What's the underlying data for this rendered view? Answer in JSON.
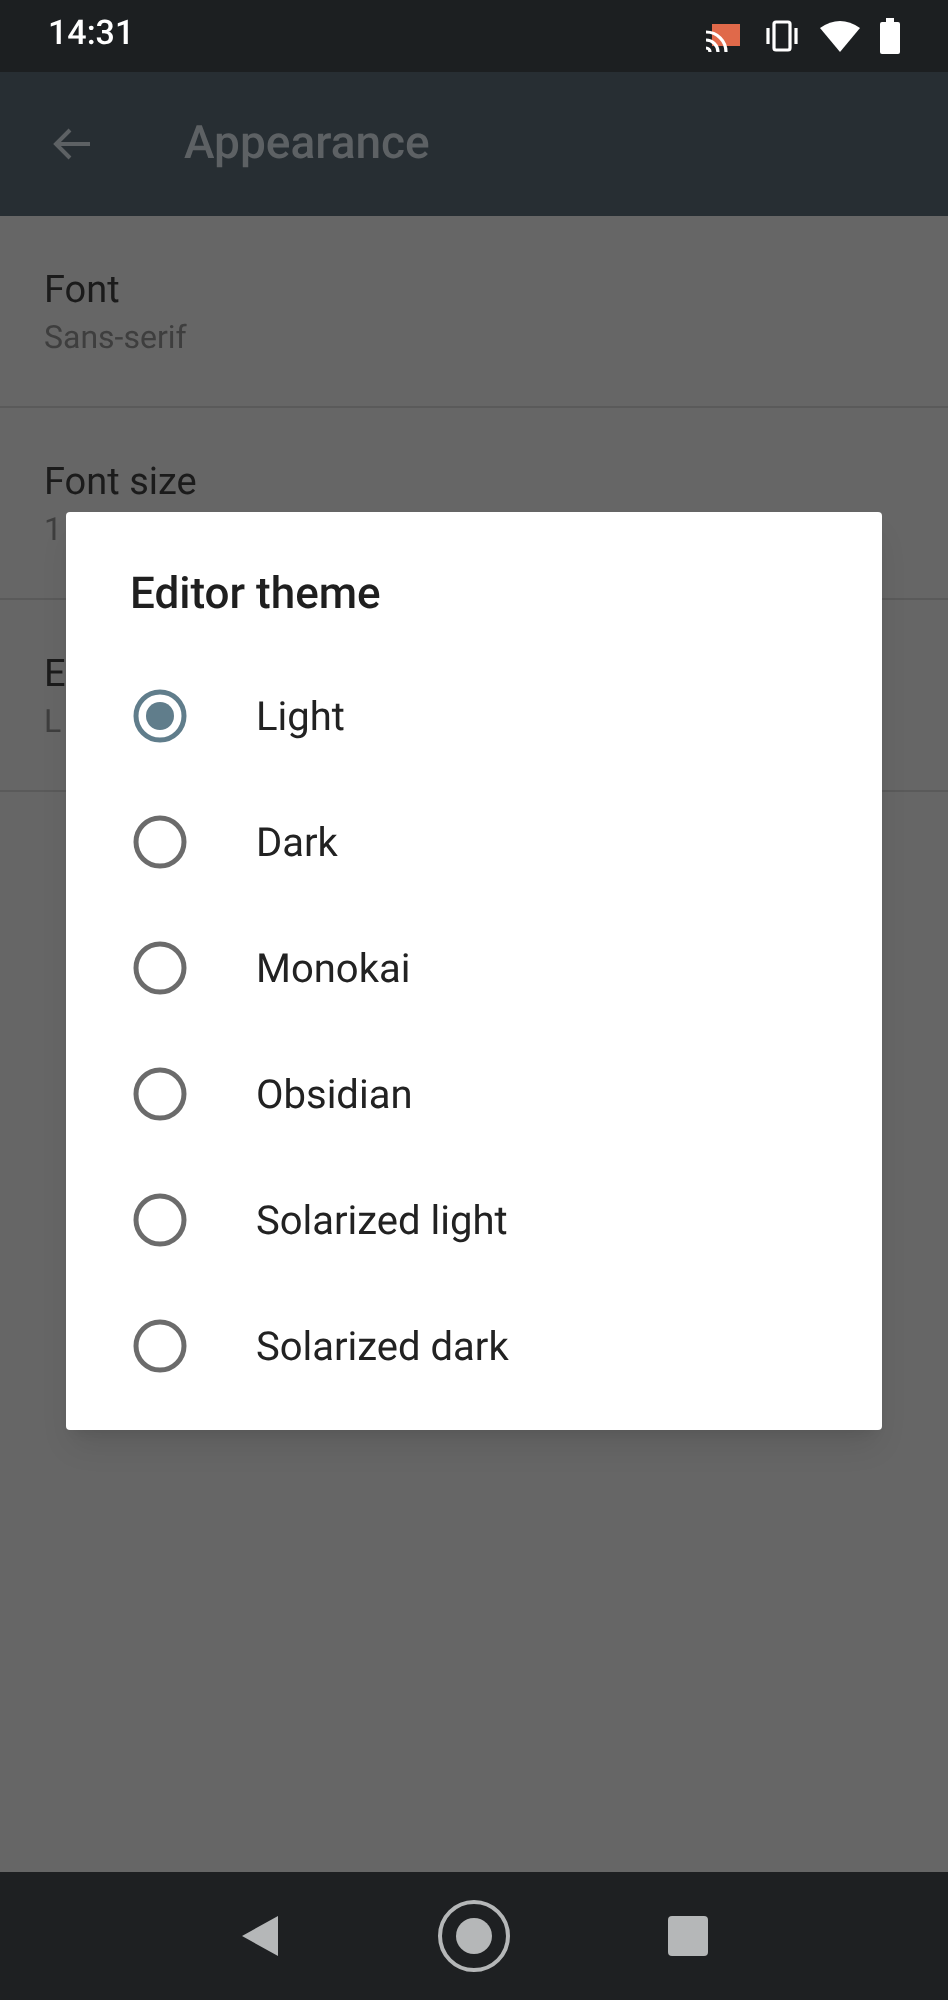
{
  "status_bar": {
    "time": "14:31"
  },
  "app_bar": {
    "title": "Appearance"
  },
  "settings": [
    {
      "title": "Font",
      "value": "Sans-serif"
    },
    {
      "title": "Font size",
      "value": "1"
    },
    {
      "title": "E",
      "value": "L"
    }
  ],
  "dialog": {
    "title": "Editor theme",
    "options": [
      {
        "label": "Light",
        "selected": true
      },
      {
        "label": "Dark",
        "selected": false
      },
      {
        "label": "Monokai",
        "selected": false
      },
      {
        "label": "Obsidian",
        "selected": false
      },
      {
        "label": "Solarized light",
        "selected": false
      },
      {
        "label": "Solarized dark",
        "selected": false
      }
    ]
  }
}
